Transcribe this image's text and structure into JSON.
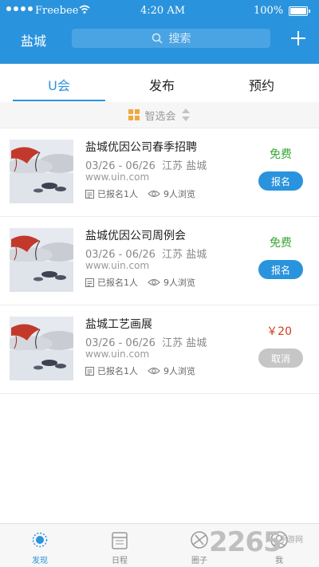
{
  "status_bar": {
    "carrier": "Freebee",
    "time": "4:20 AM",
    "battery": "100%"
  },
  "header": {
    "city": "盐城",
    "search_placeholder": "搜索"
  },
  "tabs": [
    {
      "label": "U会",
      "active": true
    },
    {
      "label": "发布",
      "active": false
    },
    {
      "label": "预约",
      "active": false
    }
  ],
  "filter": {
    "label": "智选会"
  },
  "events": [
    {
      "title": "盐城优因公司春季招聘",
      "dates": "03/26 - 06/26",
      "location": "江苏 盐城",
      "website": "www.uin.com",
      "enrolled": "已报名1人",
      "views": "9人浏览",
      "price": "免费",
      "action": "报名"
    },
    {
      "title": "盐城优因公司周例会",
      "dates": "03/26 - 06/26",
      "location": "江苏 盐城",
      "website": "www.uin.com",
      "enrolled": "已报名1人",
      "views": "9人浏览",
      "price": "免费",
      "action": "报名"
    },
    {
      "title": "盐城工艺画展",
      "dates": "03/26 - 06/26",
      "location": "江苏 盐城",
      "website": "www.uin.com",
      "enrolled": "已报名1人",
      "views": "9人浏览",
      "price": "￥20",
      "action": "取消"
    }
  ],
  "bottom_nav": [
    {
      "label": "发现",
      "icon": "discover-icon",
      "active": true
    },
    {
      "label": "日程",
      "icon": "calendar-icon",
      "active": false
    },
    {
      "label": "圈子",
      "icon": "circle-icon",
      "active": false
    },
    {
      "label": "我",
      "icon": "profile-icon",
      "active": false
    }
  ],
  "watermark": {
    "text": "2265",
    "sub": "手游网"
  },
  "colors": {
    "primary": "#2a93dd",
    "free": "#39a935",
    "paid": "#d0401c",
    "disabled": "#c6c6c6"
  }
}
